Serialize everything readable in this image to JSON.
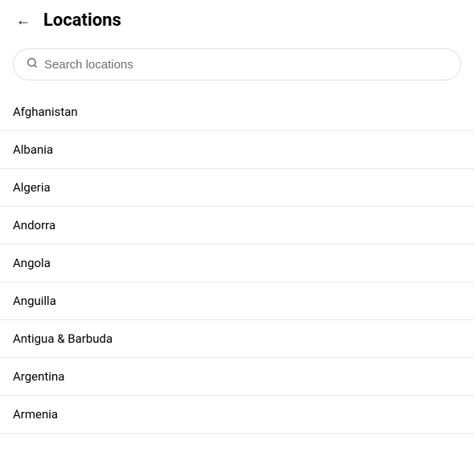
{
  "header": {
    "title": "Locations",
    "back_label": "←"
  },
  "search": {
    "placeholder": "Search locations"
  },
  "locations": [
    {
      "name": "Afghanistan"
    },
    {
      "name": "Albania"
    },
    {
      "name": "Algeria"
    },
    {
      "name": "Andorra"
    },
    {
      "name": "Angola"
    },
    {
      "name": "Anguilla"
    },
    {
      "name": "Antigua & Barbuda"
    },
    {
      "name": "Argentina"
    },
    {
      "name": "Armenia"
    }
  ]
}
